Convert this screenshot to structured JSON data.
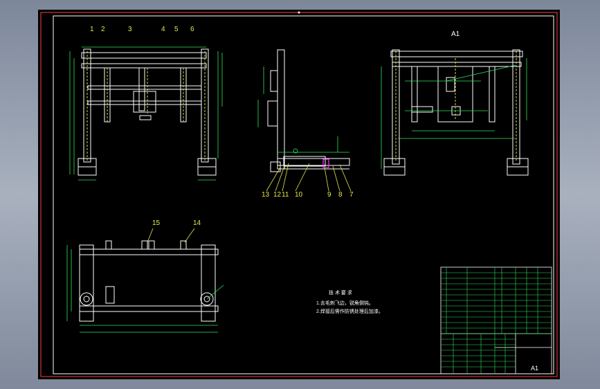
{
  "sheet": {
    "view_a_label": "A1",
    "title_block_sheet_label": "A1",
    "balloons_front": [
      "1",
      "2",
      "3",
      "4",
      "5",
      "6"
    ],
    "balloons_side": [
      "13",
      "12",
      "11",
      "10",
      "9",
      "8",
      "7"
    ],
    "balloons_top": [
      "15",
      "14"
    ],
    "notes_heading": "技 术 要 求",
    "notes": [
      "1.去毛刺飞边，锐角倒钝。",
      "2.焊接后需作防锈处理后加漆。"
    ]
  },
  "colors": {
    "frame_line": "#ff3b3b",
    "profile": "#ffffff",
    "dimension": "#2ee65c",
    "leader": "#e9e94a",
    "hidden": "#d8d84a",
    "highlight": "#ff33ff",
    "title_block_grid": "#2ee65c"
  }
}
